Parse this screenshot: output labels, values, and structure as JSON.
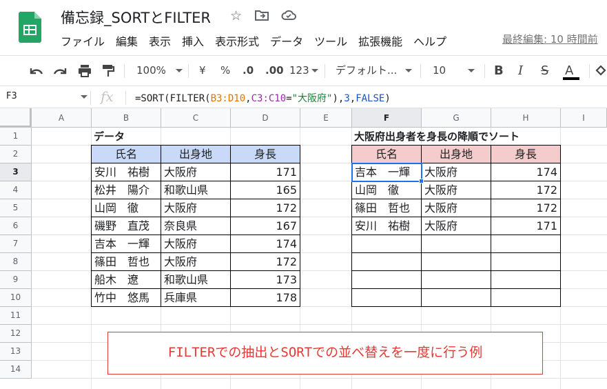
{
  "app": {
    "doc_title": "備忘録_SORTとFILTER",
    "menu": [
      "ファイル",
      "編集",
      "表示",
      "挿入",
      "表示形式",
      "データ",
      "ツール",
      "拡張機能",
      "ヘルプ"
    ],
    "last_edit": "最終編集: 10 時間前"
  },
  "toolbar": {
    "zoom": "100%",
    "currency": "¥",
    "percent": "%",
    "dec_decrease": ".0",
    "dec_increase": ".00",
    "format_more": "123",
    "font": "デフォルト...",
    "font_size": "10",
    "bold": "B",
    "italic": "I",
    "strike": "S",
    "text_color": "A"
  },
  "formula_bar": {
    "name_box": "F3",
    "fx": "fx",
    "formula_parts": [
      {
        "text": "=SORT(FILTER(",
        "color": "#202124"
      },
      {
        "text": "B3:D10",
        "color": "#e37400"
      },
      {
        "text": ",",
        "color": "#202124"
      },
      {
        "text": "C3:C10",
        "color": "#9c27b0"
      },
      {
        "text": "=",
        "color": "#202124"
      },
      {
        "text": "\"大阪府\"",
        "color": "#188038"
      },
      {
        "text": "),",
        "color": "#202124"
      },
      {
        "text": "3",
        "color": "#1155cc"
      },
      {
        "text": ",",
        "color": "#202124"
      },
      {
        "text": "FALSE",
        "color": "#1155cc"
      },
      {
        "text": ")",
        "color": "#202124"
      }
    ]
  },
  "columns": [
    "A",
    "B",
    "C",
    "D",
    "E",
    "F",
    "G",
    "H",
    "I"
  ],
  "rows": [
    "1",
    "2",
    "3",
    "4",
    "5",
    "6",
    "7",
    "8",
    "9",
    "10",
    "11",
    "12",
    "13",
    "14"
  ],
  "left_table": {
    "title": "データ",
    "headers": [
      "氏名",
      "出身地",
      "身長"
    ],
    "rows": [
      [
        "安川　祐樹",
        "大阪府",
        "171"
      ],
      [
        "松井　陽介",
        "和歌山県",
        "165"
      ],
      [
        "山岡　徹",
        "大阪府",
        "172"
      ],
      [
        "磯野　直茂",
        "奈良県",
        "167"
      ],
      [
        "吉本　一輝",
        "大阪府",
        "174"
      ],
      [
        "篠田　哲也",
        "大阪府",
        "172"
      ],
      [
        "船木　遼",
        "和歌山県",
        "173"
      ],
      [
        "竹中　悠馬",
        "兵庫県",
        "178"
      ]
    ]
  },
  "right_table": {
    "title": "大阪府出身者を身長の降順でソート",
    "headers": [
      "氏名",
      "出身地",
      "身長"
    ],
    "rows": [
      [
        "吉本　一輝",
        "大阪府",
        "174"
      ],
      [
        "山岡　徹",
        "大阪府",
        "172"
      ],
      [
        "篠田　哲也",
        "大阪府",
        "172"
      ],
      [
        "安川　祐樹",
        "大阪府",
        "171"
      ],
      [
        "",
        "",
        ""
      ],
      [
        "",
        "",
        ""
      ],
      [
        "",
        "",
        ""
      ],
      [
        "",
        "",
        ""
      ]
    ]
  },
  "annotation": "FILTERでの抽出とSORTでの並べ替えを一度に行う例",
  "colors": {
    "header_blue": "#c9daf8",
    "header_red": "#f4cccc",
    "selection": "#1a73e8",
    "annotation_red": "#e53935",
    "sheets_green": "#23a566"
  }
}
